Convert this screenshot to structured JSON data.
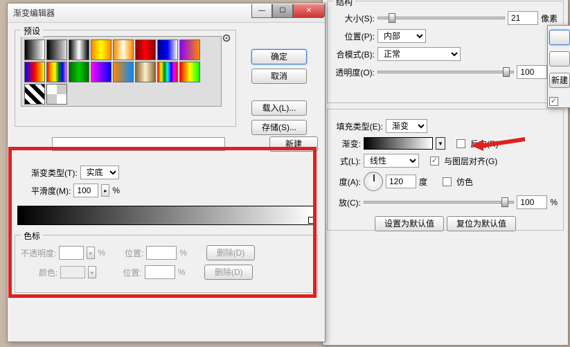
{
  "layer_style": {
    "section_struct": "结构",
    "size_label": "大小(S):",
    "size_value": "21",
    "size_unit": "像素",
    "position_label": "位置(P):",
    "position_value": "内部",
    "blend_label": "合模式(B):",
    "blend_value": "正常",
    "opacity_label": "透明度(O):",
    "opacity_value": "100",
    "pct": "%",
    "fill_type_label": "填充类型(E):",
    "fill_type_value": "渐变",
    "gradient_label": "渐变:",
    "reverse_label": "反向(R)",
    "style_label": "式(L):",
    "style_value": "线性",
    "align_label": "与图层对齐(G)",
    "angle_label": "度(A):",
    "angle_value": "120",
    "angle_unit": "度",
    "dither_label": "仿色",
    "scale_label": "放(C):",
    "scale_value": "100",
    "make_default": "设置为默认值",
    "reset_default": "复位为默认值",
    "new_btn": "新建"
  },
  "editor": {
    "title": "渐变编辑器",
    "presets_label": "预设",
    "ok": "确定",
    "cancel": "取消",
    "load": "载入(L)...",
    "save": "存储(S)...",
    "new": "新建",
    "grad_type_label": "渐变类型(T):",
    "grad_type_value": "实底",
    "smooth_label": "平滑度(M):",
    "smooth_value": "100",
    "pct": "%",
    "stops_label": "色标",
    "opacity_label": "不透明度:",
    "loc_label": "位置:",
    "delete": "删除(D)",
    "color_label": "颜色:"
  },
  "chart_data": {
    "type": "gradient",
    "stops": [
      {
        "position": 0,
        "color": "#000000",
        "opacity": 100
      },
      {
        "position": 100,
        "color": "#ffffff",
        "opacity": 100
      }
    ],
    "smoothness": 100,
    "gradient_type": "solid"
  },
  "preset_gradients": [
    "linear-gradient(to right,#000,#fff)",
    "linear-gradient(to right,#000,rgba(0,0,0,0))",
    "linear-gradient(to right,#000,#fff,#000)",
    "linear-gradient(to right,#f80,#ff0,#f80)",
    "linear-gradient(to right,#f80,#ffd,#f80)",
    "linear-gradient(to right,#800,#f00,#800)",
    "linear-gradient(to right,#008,#00f,#fff)",
    "linear-gradient(to right,#80f,#f80)",
    "linear-gradient(to right,#00f,#f00,#ff0)",
    "linear-gradient(to right,red,orange,yellow,green,blue,violet)",
    "linear-gradient(to right,#060,#0c0,#060)",
    "linear-gradient(to right,#f0f,#00f)",
    "linear-gradient(to right,#f80,#08f)",
    "linear-gradient(to right,#863,#fec,#863)",
    "linear-gradient(to right,red,yellow,green,cyan,blue,magenta,red)",
    "linear-gradient(to right,#f00,#ff0,#0f0)",
    "repeating-linear-gradient(45deg,#000 0 6px,#fff 6px 12px)",
    "repeating-conic-gradient(#ccc 0 25%,#fff 0 50%)"
  ]
}
